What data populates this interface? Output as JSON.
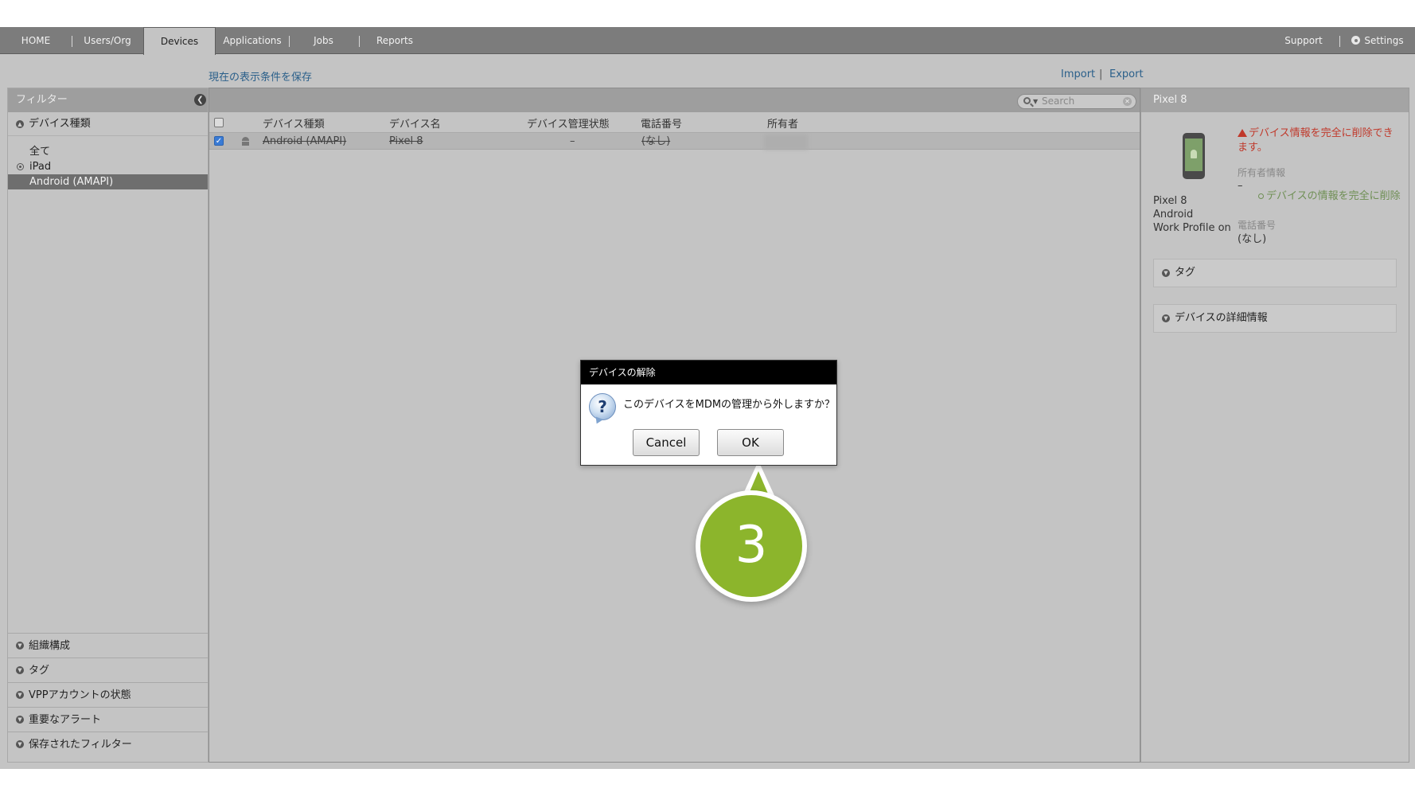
{
  "nav": {
    "tabs": [
      "HOME",
      "Users/Org",
      "Devices",
      "Applications",
      "Jobs",
      "Reports"
    ],
    "active_tab": "Devices",
    "support": "Support",
    "settings": "Settings"
  },
  "toolbar": {
    "save_view": "現在の表示条件を保存",
    "import": "Import",
    "separator": "|",
    "export": "Export"
  },
  "sidebar": {
    "title": "フィルター",
    "section": "デバイス種類",
    "items": [
      "全て",
      "iPad",
      "Android (AMAPI)"
    ],
    "selected": "Android (AMAPI)",
    "bottom_sections": [
      "組織構成",
      "タグ",
      "VPPアカウントの状態",
      "重要なアラート",
      "保存されたフィルター"
    ]
  },
  "table": {
    "search_placeholder": "Search",
    "columns": [
      "デバイス種類",
      "デバイス名",
      "デバイス管理状態",
      "電話番号",
      "所有者"
    ],
    "rows": [
      {
        "checked": true,
        "type": "Android (AMAPI)",
        "name": "Pixel 8",
        "status": "–",
        "phone": "(なし)",
        "owner": ""
      }
    ]
  },
  "detail": {
    "title": "Pixel 8",
    "device_name": "Pixel 8",
    "platform": "Android",
    "profile": "Work Profile on",
    "warning": "デバイス情報を完全に削除できます。",
    "owner_label": "所有者情報",
    "owner_value": "–",
    "delete_link": "デバイスの情報を完全に削除",
    "phone_label": "電話番号",
    "phone_value": "(なし)",
    "sections": [
      "タグ",
      "デバイスの詳細情報"
    ]
  },
  "dialog": {
    "title": "デバイスの解除",
    "message": "このデバイスをMDMの管理から外しますか？",
    "cancel": "Cancel",
    "ok": "OK"
  },
  "callout": {
    "step": "3"
  },
  "colors": {
    "nav_bg": "#7c7c7c",
    "callout_green": "#8cb52c",
    "warning_red": "#c0392b",
    "link_blue": "#2a5f8a"
  }
}
